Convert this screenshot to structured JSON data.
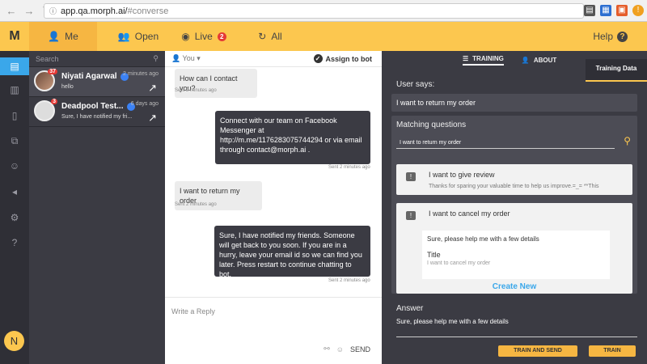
{
  "browser": {
    "url_host": "app.qa.morph.ai/",
    "url_path": "#converse"
  },
  "topbar": {
    "logo": "M",
    "tabs": [
      {
        "label": "Me",
        "icon": "users-icon"
      },
      {
        "label": "Open",
        "icon": "group-icon"
      },
      {
        "label": "Live",
        "icon": "live-icon",
        "badge": "2"
      },
      {
        "label": "All",
        "icon": "refresh-icon"
      }
    ],
    "help": "Help",
    "help_icon": "?"
  },
  "rail": {
    "avatar_letter": "N"
  },
  "convlist": {
    "search_placeholder": "Search",
    "items": [
      {
        "name": "Niyati Agarwal",
        "time": "2 minutes ago",
        "preview": "hello",
        "count": "37"
      },
      {
        "name": "Deadpool Test...",
        "time": "6 days ago",
        "preview": "Sure, I have notified my fri...",
        "count": "3"
      }
    ]
  },
  "chat": {
    "agent": "You",
    "assign": "Assign to bot",
    "messages": [
      {
        "text": "How can I contact you?",
        "stamp": "Sent 2 minutes ago"
      },
      {
        "text": "Connect with our team on Facebook Messenger at http://m.me/1176283075744294 or via email through contact@morph.ai .",
        "stamp": "Sent 2 minutes ago"
      },
      {
        "text": "I want to return my order",
        "stamp": "Sent 2 minutes ago"
      },
      {
        "text": "Sure, I have notified my friends. Someone will get back to you soon. If you are in a hurry, leave your email id so we can find you later. Press restart to continue chatting to bot.",
        "stamp": "Sent 2 minutes ago"
      }
    ],
    "reply_placeholder": "Write a Reply",
    "send": "SEND"
  },
  "training": {
    "tab_training": "TRAINING",
    "tab_about": "ABOUT",
    "training_data": "Training Data",
    "user_says_label": "User says:",
    "user_says_value": "I want to return my order",
    "matching_label": "Matching questions",
    "matching_search": "I want to return my order",
    "cards": [
      {
        "title": "I want to give review",
        "subtitle": "Thanks for sparing your valuable time to help us improve.=_= **This"
      },
      {
        "title": "I want to cancel my order",
        "answer": "Sure, please help me with a few details",
        "inner_title": "Title",
        "inner_sub": "I want to cancel my order"
      }
    ],
    "create_new": "Create New",
    "answer_label": "Answer",
    "answer_value": "Sure, please help me with a few details",
    "train_and_send": "TRAIN AND SEND",
    "train": "TRAIN"
  }
}
